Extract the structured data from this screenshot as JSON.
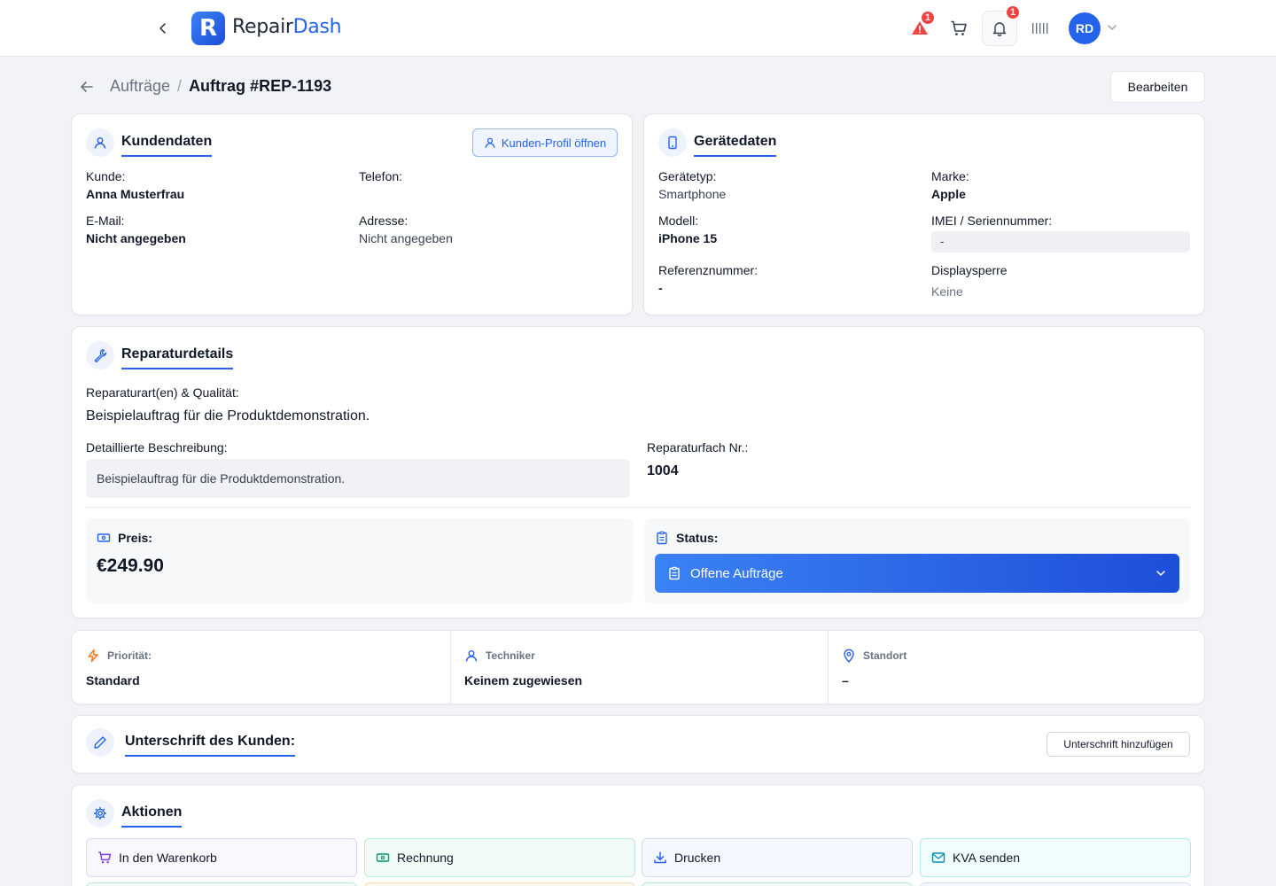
{
  "header": {
    "brand_part1": "Repair",
    "brand_part2": "Dash",
    "logo_letter": "R",
    "alert_count": "1",
    "notification_count": "1",
    "avatar_initials": "RD",
    "icons": [
      "chevron-left-icon",
      "alert-triangle-icon",
      "cart-icon",
      "bell-icon",
      "barcode-icon",
      "chevron-down-icon"
    ]
  },
  "breadcrumb": {
    "parent": "Aufträge",
    "separator": "/",
    "current": "Auftrag #REP-1193",
    "edit_label": "Bearbeiten"
  },
  "customer": {
    "title": "Kundendaten",
    "profile_button": "Kunden-Profil öffnen",
    "fields": {
      "customer_label": "Kunde:",
      "customer_value": "Anna Musterfrau",
      "phone_label": "Telefon:",
      "phone_value": "",
      "email_label": "E-Mail:",
      "email_value": "Nicht angegeben",
      "address_label": "Adresse:",
      "address_value": "Nicht angegeben"
    }
  },
  "device": {
    "title": "Gerätedaten",
    "type_label": "Gerätetyp:",
    "type_value": "Smartphone",
    "brand_label": "Marke:",
    "brand_value": "Apple",
    "model_label": "Modell:",
    "model_value": "iPhone 15",
    "imei_label": "IMEI / Seriennummer:",
    "imei_value": "-",
    "ref_label": "Referenznummer:",
    "ref_value": "-",
    "lock_label": "Displaysperre",
    "lock_value": "Keine"
  },
  "repair": {
    "title": "Reparaturdetails",
    "types_label": "Reparaturart(en) & Qualität:",
    "types_value": "Beispielauftrag für die Produktdemonstration.",
    "desc_label": "Detaillierte Beschreibung:",
    "desc_value": "Beispielauftrag für die Produktdemonstration.",
    "bin_label": "Reparaturfach Nr.:",
    "bin_value": "1004",
    "price_label": "Preis:",
    "price_value": "€249.90",
    "status_label": "Status:",
    "status_value": "Offene Aufträge"
  },
  "meta": {
    "priority_label": "Priorität:",
    "priority_value": "Standard",
    "tech_label": "Techniker",
    "tech_value": "Keinem zugewiesen",
    "location_label": "Standort",
    "location_value": "–"
  },
  "signature": {
    "title": "Unterschrift des Kunden:",
    "add_button": "Unterschrift hinzufügen"
  },
  "actions": {
    "title": "Aktionen",
    "cart": "In den Warenkorb",
    "invoice": "Rechnung",
    "print": "Drucken",
    "kva": "KVA senden"
  },
  "colors": {
    "accent": "#2563eb",
    "danger": "#ef4444",
    "priority": "#f97316"
  }
}
